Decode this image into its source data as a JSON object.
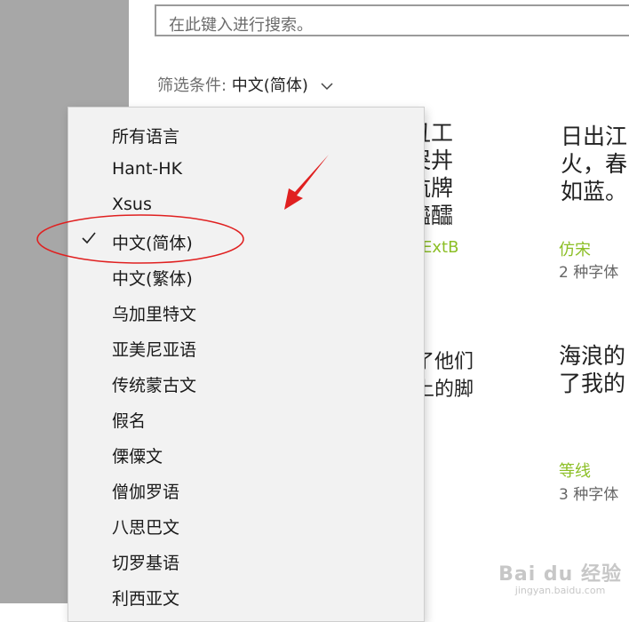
{
  "search": {
    "placeholder": "在此键入进行搜索。"
  },
  "filter": {
    "label": "筛选条件: ",
    "value": "中文(简体)"
  },
  "cards": [
    {
      "preview_lines": [
        "工丑工",
        "嵒哭丼",
        "霾航牌",
        "霾醯醽"
      ],
      "name": "ExtB",
      "count": ""
    },
    {
      "preview_lines": [
        "日出江",
        "火，春",
        "如蓝。"
      ],
      "name": "仿宋",
      "count": "2 种字体"
    },
    {
      "preview_lines": [
        "淡了他们",
        "滩上的脚"
      ],
      "name": "",
      "count": ""
    },
    {
      "preview_lines": [
        "海浪的",
        "了我的"
      ],
      "name": "等线",
      "count": "3 种字体"
    }
  ],
  "dropdown": {
    "items": [
      {
        "label": "所有语言",
        "selected": false
      },
      {
        "label": "Hant-HK",
        "selected": false
      },
      {
        "label": "Xsus",
        "selected": false
      },
      {
        "label": "中文(简体)",
        "selected": true
      },
      {
        "label": "中文(繁体)",
        "selected": false
      },
      {
        "label": "乌加里特文",
        "selected": false
      },
      {
        "label": "亚美尼亚语",
        "selected": false
      },
      {
        "label": "传统蒙古文",
        "selected": false
      },
      {
        "label": "假名",
        "selected": false
      },
      {
        "label": "傈僳文",
        "selected": false
      },
      {
        "label": "僧伽罗语",
        "selected": false
      },
      {
        "label": "八思巴文",
        "selected": false
      },
      {
        "label": "切罗基语",
        "selected": false
      },
      {
        "label": "利西亚文",
        "selected": false
      }
    ]
  },
  "colors": {
    "accent_green": "#8cbf26",
    "annotation_red": "#e02020"
  },
  "icons": {
    "filter_chevron": "chevron-down-icon",
    "selected_mark": "checkmark-icon"
  },
  "watermark": {
    "logo": "Bai du 经验",
    "url": "jingyan.baidu.com"
  }
}
